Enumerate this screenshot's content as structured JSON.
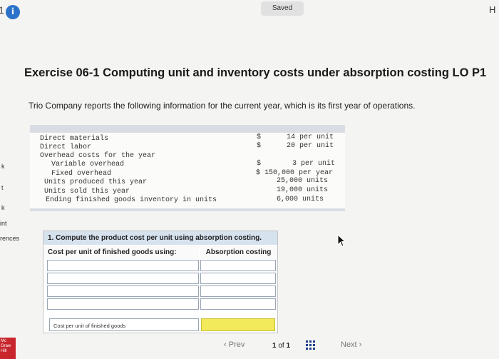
{
  "header": {
    "number_fragment": "1",
    "info_icon": "info-icon",
    "saved_label": "Saved",
    "corner_fragment": "H"
  },
  "sidebar": {
    "items": [
      "k",
      "t",
      "k",
      "int",
      "rences"
    ]
  },
  "exercise": {
    "title": "Exercise 06-1 Computing unit and inventory costs under absorption costing LO P1",
    "intro": "Trio Company reports the following information for the current year, which is its first year of operations."
  },
  "info_table": {
    "rows": [
      {
        "label": "Direct materials",
        "currency": "$",
        "value": "14 per unit"
      },
      {
        "label": "Direct labor",
        "currency": "$",
        "value": "20 per unit"
      },
      {
        "label": "Overhead costs for the year",
        "currency": "",
        "value": ""
      },
      {
        "label": "Variable overhead",
        "currency": "$",
        "value": "3 per unit"
      },
      {
        "label": "Fixed overhead",
        "currency": "",
        "value": "$ 150,000 per year"
      },
      {
        "label": "Units produced this year",
        "currency": "",
        "value": "25,000 units"
      },
      {
        "label": "Units sold this year",
        "currency": "",
        "value": "19,000 units"
      },
      {
        "label": "Ending finished goods inventory in units",
        "currency": "",
        "value": "6,000 units"
      }
    ]
  },
  "question": {
    "title": "1. Compute the product cost per unit using absorption costing.",
    "col_left": "Cost per unit of finished goods using:",
    "col_right": "Absorption costing",
    "footer_label": "Cost per unit of finished goods",
    "answer_highlight_color": "#f3ea5b"
  },
  "pager": {
    "prev": "Prev",
    "page": "1",
    "of": "of",
    "total": "1",
    "next": "Next",
    "grid_icon": "grid-icon"
  },
  "logo": {
    "text": "Mc Graw Hill"
  }
}
